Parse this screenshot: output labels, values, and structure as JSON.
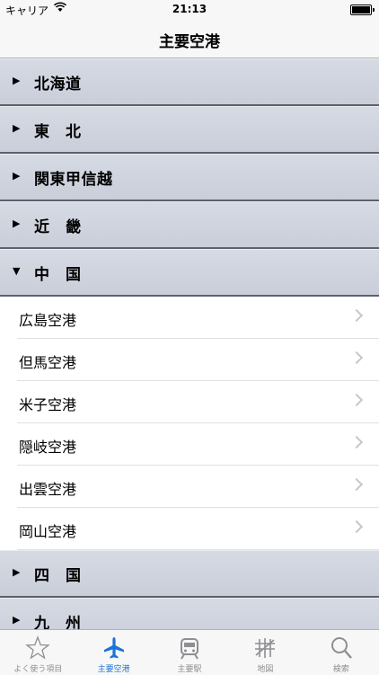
{
  "status_bar": {
    "carrier": "キャリア",
    "time": "21:13"
  },
  "nav": {
    "title": "主要空港"
  },
  "sections": [
    {
      "label": "北海道",
      "expanded": false
    },
    {
      "label": "東　北",
      "expanded": false
    },
    {
      "label": "関東甲信越",
      "expanded": false
    },
    {
      "label": "近　畿",
      "expanded": false
    },
    {
      "label": "中　国",
      "expanded": true,
      "items": [
        "広島空港",
        "但馬空港",
        "米子空港",
        "隠岐空港",
        "出雲空港",
        "岡山空港"
      ]
    },
    {
      "label": "四　国",
      "expanded": false
    },
    {
      "label": "九　州",
      "expanded": false
    }
  ],
  "tabs": [
    {
      "label": "よく使う項目",
      "icon": "star-icon",
      "active": false
    },
    {
      "label": "主要空港",
      "icon": "airplane-icon",
      "active": true
    },
    {
      "label": "主要駅",
      "icon": "train-icon",
      "active": false
    },
    {
      "label": "地図",
      "icon": "map-icon",
      "active": false
    },
    {
      "label": "検索",
      "icon": "search-icon",
      "active": false
    }
  ],
  "colors": {
    "active_tab": "#1a73d9",
    "inactive_tab": "#8e8e93",
    "section_bg": "#cfd3dd"
  }
}
